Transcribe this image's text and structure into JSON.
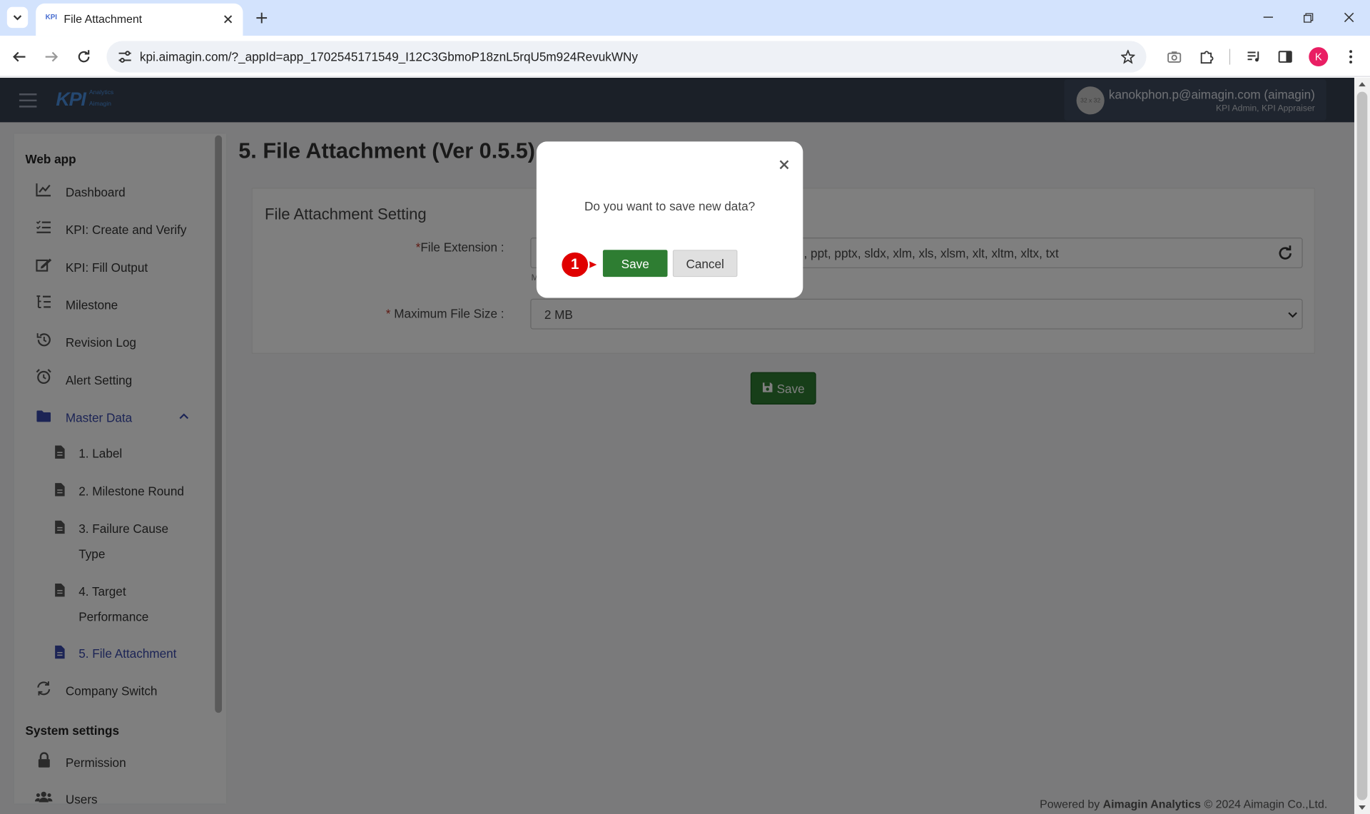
{
  "browser": {
    "tab_title": "File Attachment",
    "favicon_text": "KPI",
    "url": "kpi.aimagin.com/?_appId=app_1702545171549_I12C3GbmoP18znL5rqU5m924RevukWNy",
    "profile_initial": "K"
  },
  "app": {
    "logo_text": "KPI",
    "logo_sub_top": "Analytics",
    "logo_sub_bottom": "Aimagin",
    "avatar_text": "32 x 32",
    "user_email": "kanokphon.p@aimagin.com (aimagin)",
    "user_roles": "KPI Admin, KPI Appraiser"
  },
  "sidebar": {
    "section_webapp": "Web app",
    "items": [
      {
        "label": "Dashboard",
        "icon": "chart-line-icon"
      },
      {
        "label": "KPI: Create and Verify",
        "icon": "list-check-icon"
      },
      {
        "label": "KPI: Fill Output",
        "icon": "edit-icon"
      },
      {
        "label": "Milestone",
        "icon": "list-tree-icon"
      },
      {
        "label": "Revision Log",
        "icon": "history-icon"
      },
      {
        "label": "Alert Setting",
        "icon": "alarm-clock-icon"
      },
      {
        "label": "Master Data",
        "icon": "folder-icon"
      }
    ],
    "sub_items": [
      {
        "label": "1. Label"
      },
      {
        "label": "2. Milestone Round"
      },
      {
        "label": "3. Failure Cause Type",
        "line1": "3. Failure Cause",
        "line2": "Type"
      },
      {
        "label": "4. Target Performance",
        "line1": "4. Target",
        "line2": "Performance"
      },
      {
        "label": "5. File Attachment"
      }
    ],
    "company_switch": "Company Switch",
    "section_system": "System settings",
    "permission": "Permission",
    "users": "Users"
  },
  "main": {
    "page_title": "5. File Attachment (Ver 0.5.5)",
    "card_title": "File Attachment Setting",
    "file_ext_label": "File Extension :",
    "file_ext_value": "doc, docx, pdf, jpg, jpeg, png, gif, ppt, pptx, sldx, xlm, xls, xlsm, xlt, xltm, xltx, txt",
    "file_ext_visible": ", ppt, pptx, sldx, xlm, xls, xlsm, xlt, xltm, xltx, txt",
    "file_ext_hint": "M",
    "max_size_label": "Maximum File Size :",
    "max_size_value": "2 MB",
    "required_mark": "*",
    "save_label": "Save"
  },
  "footer": {
    "prefix": "Powered by ",
    "brand": "Aimagin Analytics",
    "suffix": " © 2024 Aimagin Co.,Ltd."
  },
  "modal": {
    "question": "Do you want to save new data?",
    "save_label": "Save",
    "cancel_label": "Cancel",
    "close_symbol": "×",
    "step_number": "1"
  },
  "colors": {
    "accent_green": "#2e7d32",
    "active_link": "#3949ab",
    "marker_red": "#e00000",
    "navbar": "#374151"
  }
}
